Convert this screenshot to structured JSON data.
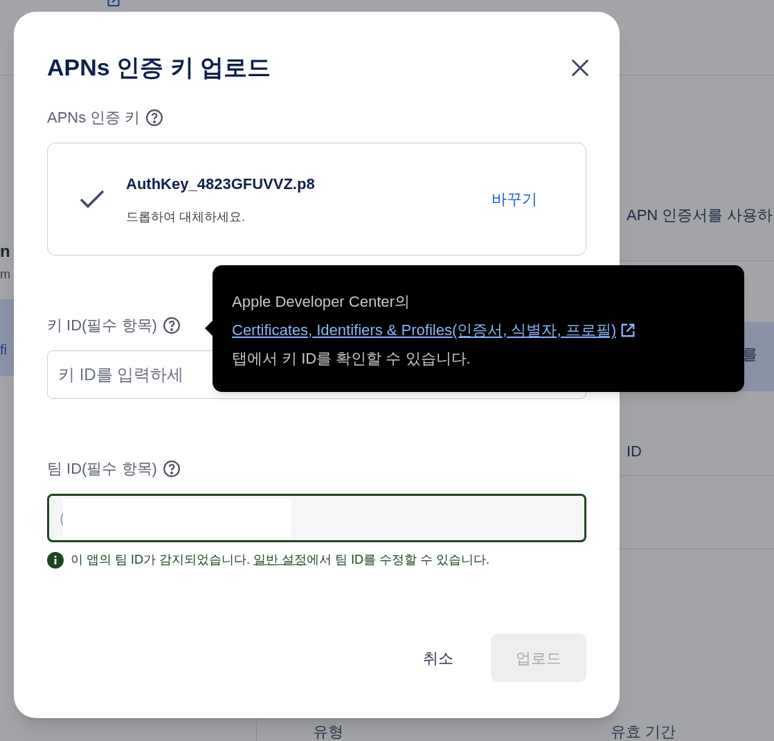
{
  "background": {
    "left_fragments": [
      "n",
      "m",
      "fi"
    ],
    "right_text": "APN 인증서를 사용하",
    "right_band_text": "를",
    "table_header_fragment": "ID",
    "footer_columns": [
      "유형",
      "유효 기간"
    ]
  },
  "dialog": {
    "title": "APNs 인증 키 업로드",
    "key_file": {
      "label": "APNs 인증 키",
      "filename": "AuthKey_4823GFUVVZ.p8",
      "hint": "드롭하여 대체하세요.",
      "action": "바꾸기"
    },
    "key_id": {
      "label": "키 ID(필수 항목)",
      "placeholder": "키 ID를 입력하세"
    },
    "team_id": {
      "label": "팀 ID(필수 항목)",
      "value": "(",
      "focused": true,
      "redacted": true,
      "message_before": "이 앱의 팀 ID가 감지되었습니다. ",
      "message_link": "일반 설정",
      "message_after": "에서 팀 ID를 수정할 수 있습니다."
    },
    "buttons": [
      {
        "label": "취소",
        "disabled": false
      },
      {
        "label": "업로드",
        "disabled": true
      }
    ]
  },
  "tooltip": {
    "line_1": "Apple Developer Center의",
    "link": "Certificates, Identifiers & Profiles(인증서, 식별자, 프로필)",
    "line_3": "탭에서 키 ID를 확인할 수 있습니다."
  }
}
